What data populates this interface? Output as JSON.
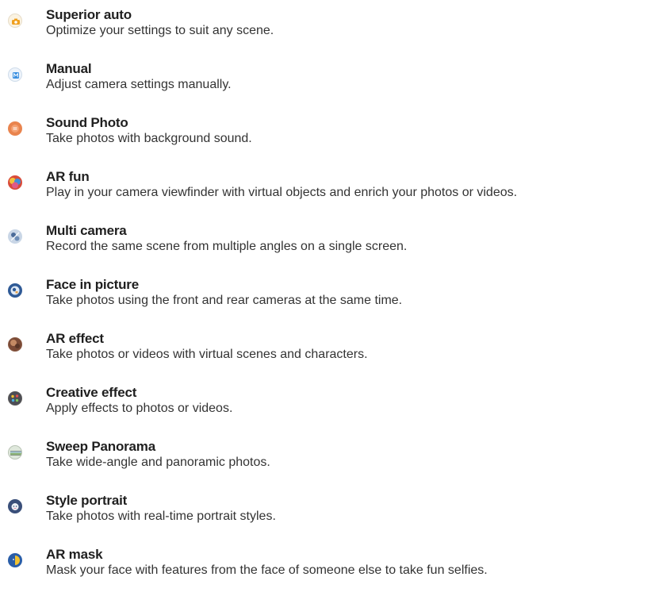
{
  "modes": [
    {
      "icon": "superior-auto-icon",
      "title": "Superior auto",
      "description": "Optimize your settings to suit any scene."
    },
    {
      "icon": "manual-icon",
      "title": "Manual",
      "description": "Adjust camera settings manually."
    },
    {
      "icon": "sound-photo-icon",
      "title": "Sound Photo",
      "description": "Take photos with background sound."
    },
    {
      "icon": "ar-fun-icon",
      "title": "AR fun",
      "description": "Play in your camera viewfinder with virtual objects and enrich your photos or videos."
    },
    {
      "icon": "multi-camera-icon",
      "title": "Multi camera",
      "description": "Record the same scene from multiple angles on a single screen."
    },
    {
      "icon": "face-in-picture-icon",
      "title": "Face in picture",
      "description": "Take photos using the front and rear cameras at the same time."
    },
    {
      "icon": "ar-effect-icon",
      "title": "AR effect",
      "description": "Take photos or videos with virtual scenes and characters."
    },
    {
      "icon": "creative-effect-icon",
      "title": "Creative effect",
      "description": "Apply effects to photos or videos."
    },
    {
      "icon": "sweep-panorama-icon",
      "title": "Sweep Panorama",
      "description": "Take wide-angle and panoramic photos."
    },
    {
      "icon": "style-portrait-icon",
      "title": "Style portrait",
      "description": "Take photos with real-time portrait styles."
    },
    {
      "icon": "ar-mask-icon",
      "title": "AR mask",
      "description": "Mask your face with features from the face of someone else to take fun selfies."
    }
  ]
}
